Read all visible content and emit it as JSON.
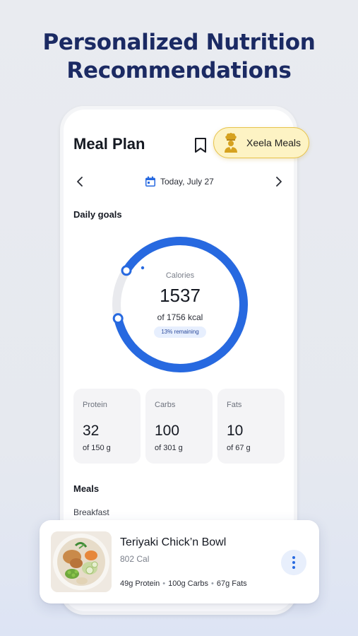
{
  "headline": {
    "line1": "Personalized Nutrition",
    "line2": "Recommendations"
  },
  "app": {
    "title": "Meal Plan",
    "badge_label": "Xeela Meals",
    "date_label": "Today, July 27"
  },
  "daily_goals": {
    "heading": "Daily goals",
    "calories_label": "Calories",
    "calories_value": "1537",
    "calories_of": "of 1756 kcal",
    "remaining_badge": "13% remaining",
    "progress_fraction": 0.875
  },
  "macros": [
    {
      "name": "Protein",
      "value": "32",
      "of": "of 150 g"
    },
    {
      "name": "Carbs",
      "value": "100",
      "of": "of 301 g"
    },
    {
      "name": "Fats",
      "value": "10",
      "of": "of 67 g"
    }
  ],
  "meals": {
    "heading": "Meals",
    "sub_heading": "Breakfast",
    "card": {
      "name": "Teriyaki Chick’n Bowl",
      "calories": "802 Cal",
      "protein": "49g Protein",
      "carbs": "100g Carbs",
      "fats": "67g Fats"
    }
  },
  "colors": {
    "accent": "#2769e0",
    "headline": "#1b2a63",
    "badge_bg": "#fdf3c4",
    "badge_border": "#e7c34a"
  },
  "icons": {
    "bookmark": "bookmark-icon",
    "chef": "chef-icon",
    "calendar": "calendar-icon",
    "prev": "chevron-left-icon",
    "next": "chevron-right-icon",
    "more": "more-vertical-icon"
  }
}
